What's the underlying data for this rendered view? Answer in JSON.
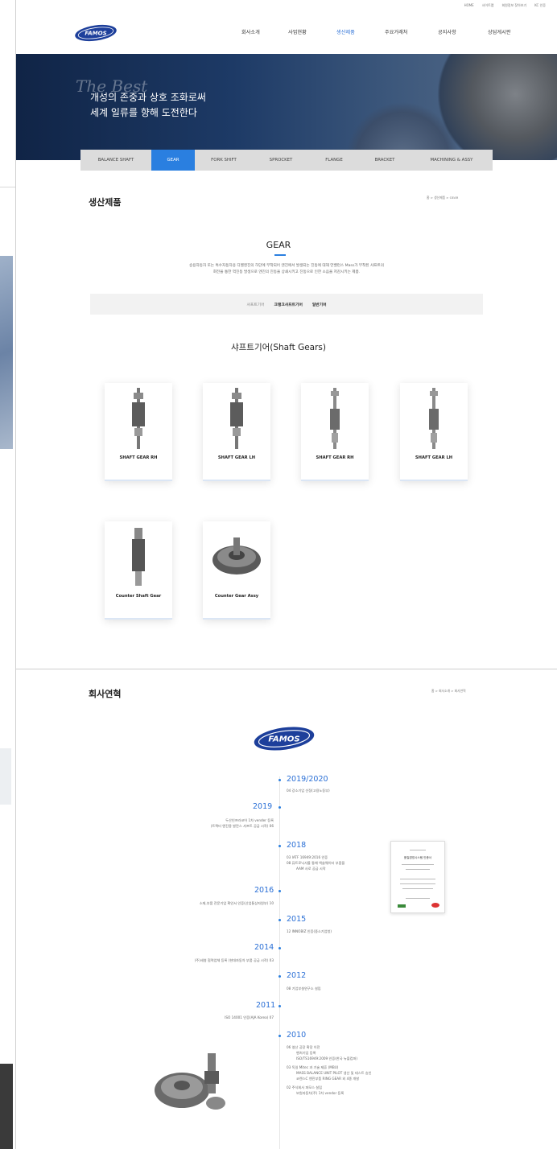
{
  "header": {
    "util_links": [
      "HOME",
      "사이트맵",
      "회원정보 찾아보기",
      "KC 인증"
    ],
    "logo_text": "FAMOS",
    "nav": [
      "회사소개",
      "사업현황",
      "생산제품",
      "주요거래처",
      "공지사항",
      "상담게시판"
    ],
    "nav_active": "생산제품"
  },
  "hero": {
    "script_text": "The Best",
    "line1": "개성의 존중과 상호 조화로써",
    "line2": "세계 일류를 향해 도전한다"
  },
  "tabs": [
    "BALANCE SHAFT",
    "GEAR",
    "FORK SHIFT",
    "SPROCKET",
    "FLANGE",
    "BRACKET",
    "MACHINING & ASSY"
  ],
  "tab_active": "GEAR",
  "products_page": {
    "title": "생산제품",
    "breadcrumb": "홈 > 생산제품 > GEAR",
    "heading": "GEAR",
    "desc1": "승용자동차 또는 특수자동차용 디젤엔진의 하단에 부착되어 엔진에서 발생되는 진동에 대해 언밸런스 Mass가 부착된 샤프트의",
    "desc2": "회전을 통한 역진동 발생으로 엔진의 진동을 상쇄시키고 진동으로 인한 소음을 저감시키는 제품.",
    "subtabs": [
      "샤프트기어",
      "크랭크샤프트기어",
      "일반기어"
    ],
    "section_title": "샤프트기어(Shaft Gears)",
    "cards": [
      "SHAFT GEAR RH",
      "SHAFT GEAR LH",
      "SHAFT GEAR RH",
      "SHAFT GEAR LH",
      "Counter Shaft Gear",
      "Counter Gear Assy"
    ]
  },
  "history_page": {
    "title": "회사연혁",
    "breadcrumb": "홈 > 회사소개 > 회사연혁",
    "logo_text": "FAMOS",
    "entries": {
      "y2019_2020": "2019/2020",
      "y2019_2020_t1": "04 강소기업 선정(고용노동부)",
      "y2019": "2019",
      "y2019_t1": "두산인프라코어 1차 vender 등록",
      "y2019_t2": "(트랙터 엔진용 발란스 샤프트 공급 시작) 06",
      "y2018": "2018",
      "y2018_t1": "03 IATF 16949:2016 인증",
      "y2018_t2": "08 퓨트로닉사를 통해 액슬웨이터 부품을",
      "y2018_t3": "AAM 사로 공급 시작",
      "y2016": "2016",
      "y2016_t1": "소재,부품 전문기업 확인서 인증(산업통상자원부) 10",
      "y2015": "2015",
      "y2015_t1": "12 INNOBIZ 인증(중소기업청)",
      "y2014": "2014",
      "y2014_t1": "(주)세영 협력업체 등록 (현대자동차 부품 공급 시작) 03",
      "y2012": "2012",
      "y2012_t1": "08 기업부설연구소 설립",
      "y2011": "2011",
      "y2011_t1": "ISO 14001 인증(AJA Korea) 07",
      "y2010": "2010",
      "y2010_t1": "06 영산 공장 확장 이전",
      "y2010_t2": "벤처기업 등록",
      "y2010_t3": "ISO/TS16949:2009 인증(한국 뉴볼컴퍼)",
      "y2010_t4": "03 독일 Mitec 과 기술 제휴 (MBU)",
      "y2010_t5": "MASS BALANCE UNIT PILOT 생산 및 테스트 승인",
      "y2010_t6": "코렌스C 엔진부품 RING GEAR 외 4종 개발",
      "y2010_t7": "02 주식회사 파모스 설립",
      "y2010_t8": "보원자동차(주) 1차 vendor 등록"
    },
    "cert_title": "품질경영시스템 인증서"
  },
  "colors": {
    "accent": "#2a7fe0",
    "hero_dark": "#102446"
  }
}
